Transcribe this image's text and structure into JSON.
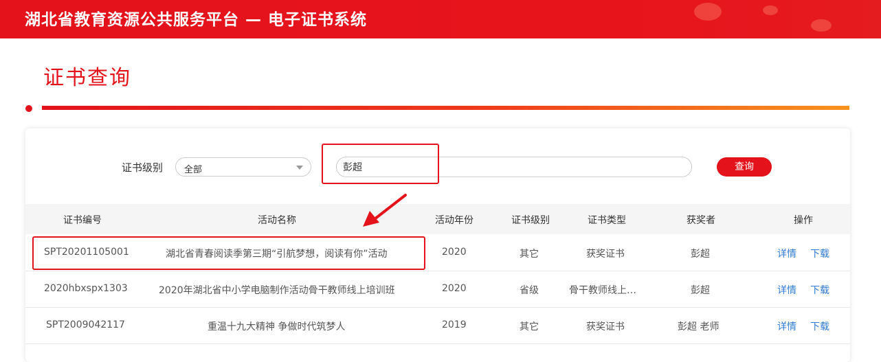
{
  "header": {
    "title": "湖北省教育资源公共服务平台   —   电子证书系统"
  },
  "page": {
    "title": "证书查询"
  },
  "filter": {
    "level_label": "证书级别",
    "level_selected": "全部",
    "search_value": "彭超",
    "query_button": "查询"
  },
  "table": {
    "columns": [
      "证书编号",
      "活动名称",
      "活动年份",
      "证书级别",
      "证书类型",
      "获奖者",
      "操作"
    ],
    "rows": [
      {
        "cert_no": "SPT20201105001",
        "activity": "湖北省青春阅读季第三期“引航梦想，阅读有你”活动",
        "year": "2020",
        "level": "其它",
        "type": "获奖证书",
        "winner": "彭超",
        "detail": "详情",
        "download": "下载"
      },
      {
        "cert_no": "2020hbxspx1303",
        "activity": "2020年湖北省中小学电脑制作活动骨干教师线上培训班",
        "year": "2020",
        "level": "省级",
        "type": "骨干教师线上…",
        "winner": "彭超",
        "detail": "详情",
        "download": "下载"
      },
      {
        "cert_no": "SPT2009042117",
        "activity": "重温十九大精神 争做时代筑梦人",
        "year": "2019",
        "level": "其它",
        "type": "获奖证书",
        "winner": "彭超 老师",
        "detail": "详情",
        "download": "下载"
      }
    ]
  },
  "colors": {
    "brand_red": "#e3121b",
    "link_blue": "#2f7bd6",
    "bar_orange": "#f7931e"
  }
}
